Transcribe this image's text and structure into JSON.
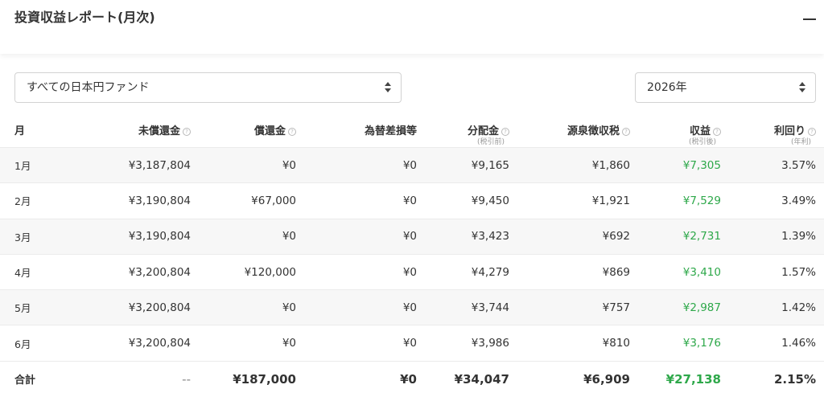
{
  "header": {
    "title": "投資収益レポート(月次)"
  },
  "filters": {
    "fund_select": {
      "value": "すべての日本円ファンド"
    },
    "year_select": {
      "value": "2026年"
    }
  },
  "colors": {
    "profit": "#2ea84a",
    "row_stripe": "#f7f7f7"
  },
  "table": {
    "columns": [
      {
        "label": "月",
        "sub": "",
        "info": false
      },
      {
        "label": "未償還金",
        "sub": "",
        "info": true
      },
      {
        "label": "償還金",
        "sub": "",
        "info": true
      },
      {
        "label": "為替差損等",
        "sub": "",
        "info": false
      },
      {
        "label": "分配金",
        "sub": "(税引前)",
        "info": true
      },
      {
        "label": "源泉徴収税",
        "sub": "",
        "info": true
      },
      {
        "label": "収益",
        "sub": "(税引後)",
        "info": true
      },
      {
        "label": "利回り",
        "sub": "(年利)",
        "info": true
      }
    ],
    "rows": [
      [
        "1月",
        "¥3,187,804",
        "¥0",
        "¥0",
        "¥9,165",
        "¥1,860",
        "¥7,305",
        "3.57%"
      ],
      [
        "2月",
        "¥3,190,804",
        "¥67,000",
        "¥0",
        "¥9,450",
        "¥1,921",
        "¥7,529",
        "3.49%"
      ],
      [
        "3月",
        "¥3,190,804",
        "¥0",
        "¥0",
        "¥3,423",
        "¥692",
        "¥2,731",
        "1.39%"
      ],
      [
        "4月",
        "¥3,200,804",
        "¥120,000",
        "¥0",
        "¥4,279",
        "¥869",
        "¥3,410",
        "1.57%"
      ],
      [
        "5月",
        "¥3,200,804",
        "¥0",
        "¥0",
        "¥3,744",
        "¥757",
        "¥2,987",
        "1.42%"
      ],
      [
        "6月",
        "¥3,200,804",
        "¥0",
        "¥0",
        "¥3,986",
        "¥810",
        "¥3,176",
        "1.46%"
      ]
    ],
    "total": [
      "合計",
      "--",
      "¥187,000",
      "¥0",
      "¥34,047",
      "¥6,909",
      "¥27,138",
      "2.15%"
    ]
  }
}
